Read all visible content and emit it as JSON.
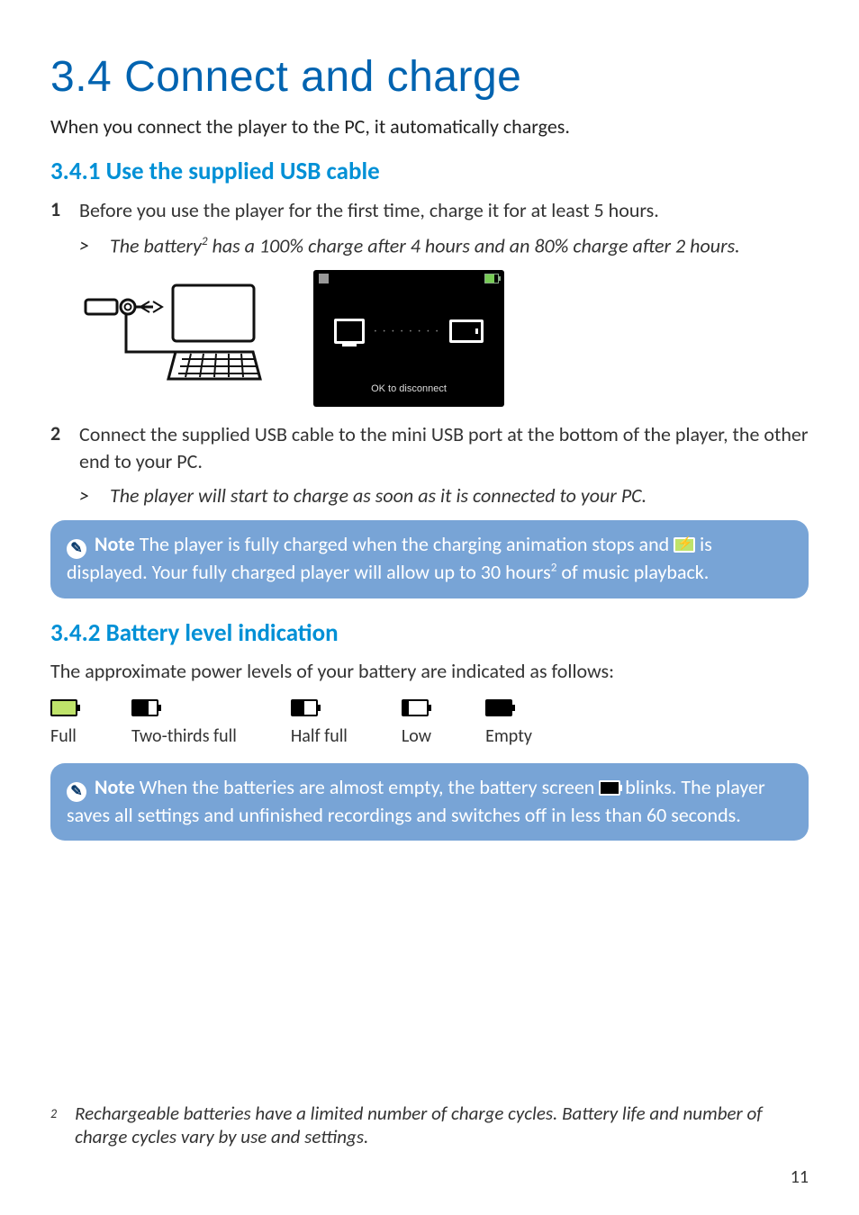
{
  "headings": {
    "h1": "3.4  Connect and charge",
    "h2_1": "3.4.1 Use the supplied USB cable",
    "h2_2": "3.4.2 Battery level indication"
  },
  "intro": "When you connect the player to the PC, it automatically charges.",
  "steps": {
    "s1_num": "1",
    "s1_text": "Before you use the player for the first time, charge it for at least 5 hours.",
    "s1_sub_mark": ">",
    "s1_sub_text_a": "The battery",
    "s1_sub_fn": "2",
    "s1_sub_text_b": " has a 100% charge after 4 hours and an 80% charge after 2 hours.",
    "s2_num": "2",
    "s2_text": "Connect the supplied USB cable to the mini USB port at the bottom of the player, the other end to your PC.",
    "s2_sub_mark": ">",
    "s2_sub_text": "The player will start to charge as soon as it is connected to your PC."
  },
  "player_screen_msg": "OK to disconnect",
  "note1": {
    "label": "Note",
    "t1": " The player is fully charged when the charging animation stops and ",
    "t2": " is displayed. Your fully charged player will allow up to 30 hours",
    "fn": "2",
    "t3": " of music playback."
  },
  "battery": {
    "intro": "The approximate power levels of your battery are indicated as follows:",
    "levels": {
      "full": "Full",
      "twothirds": "Two-thirds full",
      "half": "Half full",
      "low": "Low",
      "empty": "Empty"
    }
  },
  "note2": {
    "label": "Note",
    "t1": " When the batteries are almost empty, the battery screen ",
    "t2": " blinks. The player saves all settings and unfinished recordings and switches off in less than 60 seconds."
  },
  "footnote": {
    "num": "2",
    "text": "Rechargeable batteries have a limited number of charge cycles. Battery life and number of charge cycles vary by use and settings."
  },
  "page_number": "11"
}
